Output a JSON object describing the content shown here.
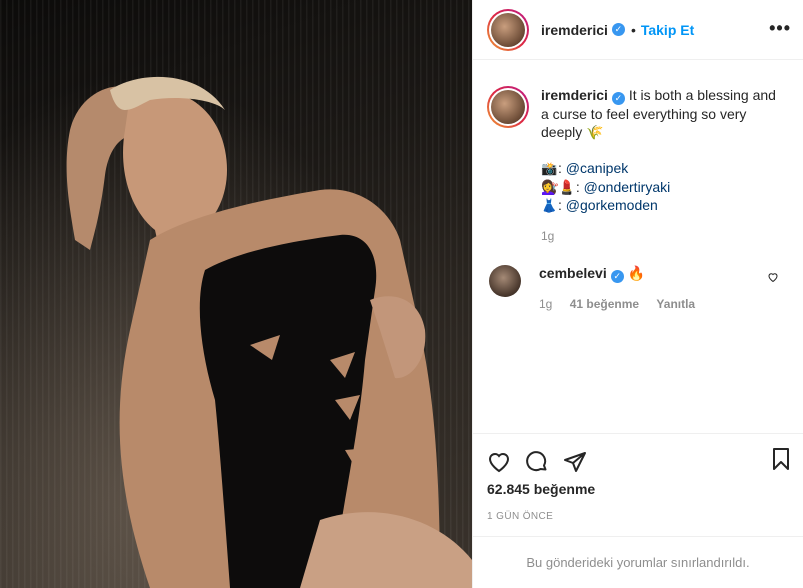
{
  "header": {
    "username": "iremderici",
    "separator": "•",
    "follow_label": "Takip Et",
    "more_label": "•••"
  },
  "caption": {
    "username": "iremderici",
    "text": "It is both a blessing and a curse to feel everything so very deeply",
    "text_emoji": "🌾",
    "credits": [
      {
        "emoji": "📸",
        "sep": ": ",
        "mention": "@canipek"
      },
      {
        "emoji": "💇‍♀️💄",
        "sep": ": ",
        "mention": "@ondertiryaki"
      },
      {
        "emoji": "👗",
        "sep": ": ",
        "mention": "@gorkemoden"
      }
    ],
    "time": "1g"
  },
  "comment": {
    "username": "cembelevi",
    "text": "🔥",
    "time": "1g",
    "likes": "41 beğenme",
    "reply_label": "Yanıtla"
  },
  "footer": {
    "likes": "62.845 beğenme",
    "date": "1 GÜN ÖNCE",
    "restricted": "Bu gönderideki yorumlar sınırlandırıldı."
  },
  "icons": {
    "verified": "verified-badge-icon",
    "like": "heart-icon",
    "comment": "comment-bubble-icon",
    "share": "paper-plane-icon",
    "save": "bookmark-icon"
  },
  "colors": {
    "accent": "#0095f6",
    "verified": "#3897f0",
    "muted": "#8e8e8e",
    "mention": "#00376b"
  }
}
